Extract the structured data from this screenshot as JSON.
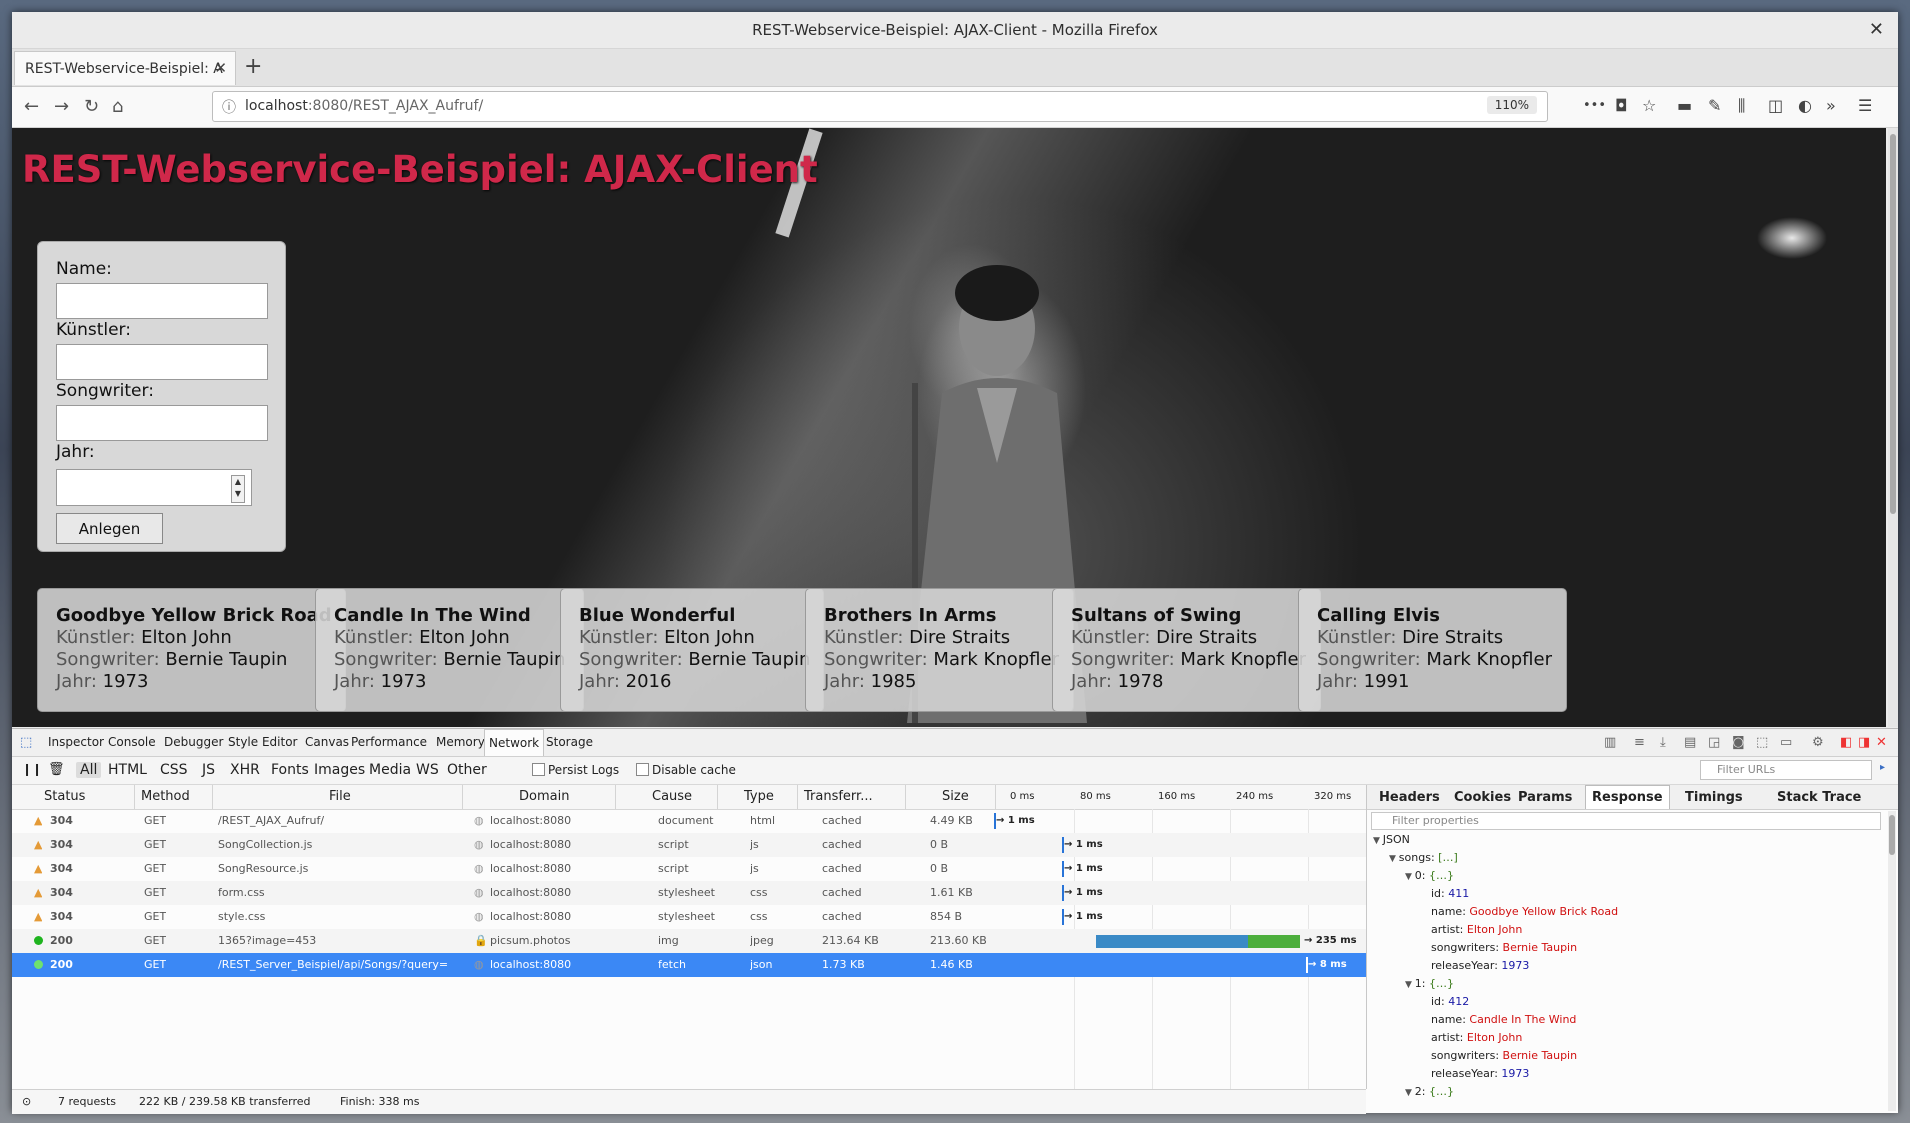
{
  "window": {
    "title": "REST-Webservice-Beispiel: AJAX-Client - Mozilla Firefox",
    "close": "✕"
  },
  "browser": {
    "tab_title": "REST-Webservice-Beispiel: A",
    "new_tab": "+",
    "url_host": "localhost",
    "url_path": ":8080/REST_AJAX_Aufruf/",
    "zoom": "110%",
    "more": "•••"
  },
  "page": {
    "title": "REST-Webservice-Beispiel: AJAX-Client",
    "form": {
      "name_label": "Name:",
      "artist_label": "Künstler:",
      "songwriter_label": "Songwriter:",
      "year_label": "Jahr:",
      "submit_label": "Anlegen"
    },
    "labels": {
      "artist": "Künstler:",
      "songwriter": "Songwriter:",
      "year": "Jahr:"
    },
    "songs": [
      {
        "name": "Goodbye Yellow Brick Road",
        "artist": "Elton John",
        "songwriter": "Bernie Taupin",
        "year": "1973"
      },
      {
        "name": "Candle In The Wind",
        "artist": "Elton John",
        "songwriter": "Bernie Taupin",
        "year": "1973"
      },
      {
        "name": "Blue Wonderful",
        "artist": "Elton John",
        "songwriter": "Bernie Taupin",
        "year": "2016"
      },
      {
        "name": "Brothers In Arms",
        "artist": "Dire Straits",
        "songwriter": "Mark Knopfler",
        "year": "1985"
      },
      {
        "name": "Sultans of Swing",
        "artist": "Dire Straits",
        "songwriter": "Mark Knopfler",
        "year": "1978"
      },
      {
        "name": "Calling Elvis",
        "artist": "Dire Straits",
        "songwriter": "Mark Knopfler",
        "year": "1991"
      }
    ]
  },
  "devtools": {
    "tabs": [
      "Inspector",
      "Console",
      "Debugger",
      "Style Editor",
      "Canvas",
      "Performance",
      "Memory",
      "Network",
      "Storage"
    ],
    "active_tab": "Network",
    "filters": [
      "All",
      "HTML",
      "CSS",
      "JS",
      "XHR",
      "Fonts",
      "Images",
      "Media",
      "WS",
      "Other"
    ],
    "persist_logs": "Persist Logs",
    "disable_cache": "Disable cache",
    "filter_urls_placeholder": "Filter URLs",
    "columns": [
      "Status",
      "Method",
      "File",
      "Domain",
      "Cause",
      "Type",
      "Transferr...",
      "Size"
    ],
    "timeline_ticks": [
      "0 ms",
      "80 ms",
      "160 ms",
      "240 ms",
      "320 ms"
    ],
    "requests": [
      {
        "status": "304",
        "method": "GET",
        "file": "/REST_AJAX_Aufruf/",
        "domain": "localhost:8080",
        "cause": "document",
        "type": "html",
        "transferred": "cached",
        "size": "4.49 KB",
        "time": "→ 1 ms"
      },
      {
        "status": "304",
        "method": "GET",
        "file": "SongCollection.js",
        "domain": "localhost:8080",
        "cause": "script",
        "type": "js",
        "transferred": "cached",
        "size": "0 B",
        "time": "→ 1 ms"
      },
      {
        "status": "304",
        "method": "GET",
        "file": "SongResource.js",
        "domain": "localhost:8080",
        "cause": "script",
        "type": "js",
        "transferred": "cached",
        "size": "0 B",
        "time": "→ 1 ms"
      },
      {
        "status": "304",
        "method": "GET",
        "file": "form.css",
        "domain": "localhost:8080",
        "cause": "stylesheet",
        "type": "css",
        "transferred": "cached",
        "size": "1.61 KB",
        "time": "→ 1 ms"
      },
      {
        "status": "304",
        "method": "GET",
        "file": "style.css",
        "domain": "localhost:8080",
        "cause": "stylesheet",
        "type": "css",
        "transferred": "cached",
        "size": "854 B",
        "time": "→ 1 ms"
      },
      {
        "status": "200",
        "method": "GET",
        "file": "1365?image=453",
        "domain": "picsum.photos",
        "cause": "img",
        "type": "jpeg",
        "transferred": "213.64 KB",
        "size": "213.60 KB",
        "time": "→ 235 ms"
      },
      {
        "status": "200",
        "method": "GET",
        "file": "/REST_Server_Beispiel/api/Songs/?query=",
        "domain": "localhost:8080",
        "cause": "fetch",
        "type": "json",
        "transferred": "1.73 KB",
        "size": "1.46 KB",
        "time": "→ 8 ms"
      }
    ],
    "summary": {
      "requests": "7 requests",
      "transferred": "222 KB / 239.58 KB transferred",
      "finish": "Finish: 338 ms"
    },
    "side_tabs": [
      "Headers",
      "Cookies",
      "Params",
      "Response",
      "Timings",
      "Stack Trace"
    ],
    "side_active": "Response",
    "filter_properties_placeholder": "Filter properties",
    "json": {
      "root": "JSON",
      "songs_key": "songs:",
      "array_marker": "[…]",
      "obj_marker": "{…}",
      "items": [
        {
          "index": "0:",
          "id": "411",
          "name": "Goodbye Yellow Brick Road",
          "artist": "Elton John",
          "songwriters": "Bernie Taupin",
          "releaseYear": "1973"
        },
        {
          "index": "1:",
          "id": "412",
          "name": "Candle In The Wind",
          "artist": "Elton John",
          "songwriters": "Bernie Taupin",
          "releaseYear": "1973"
        }
      ],
      "next_index": "2:",
      "keys": {
        "id": "id:",
        "name": "name:",
        "artist": "artist:",
        "songwriters": "songwriters:",
        "releaseYear": "releaseYear:"
      }
    }
  },
  "colors": {
    "title": "#d0284a",
    "selected_row": "#3b88f5",
    "json_string": "#d01010",
    "json_number": "#1a1aa6"
  }
}
